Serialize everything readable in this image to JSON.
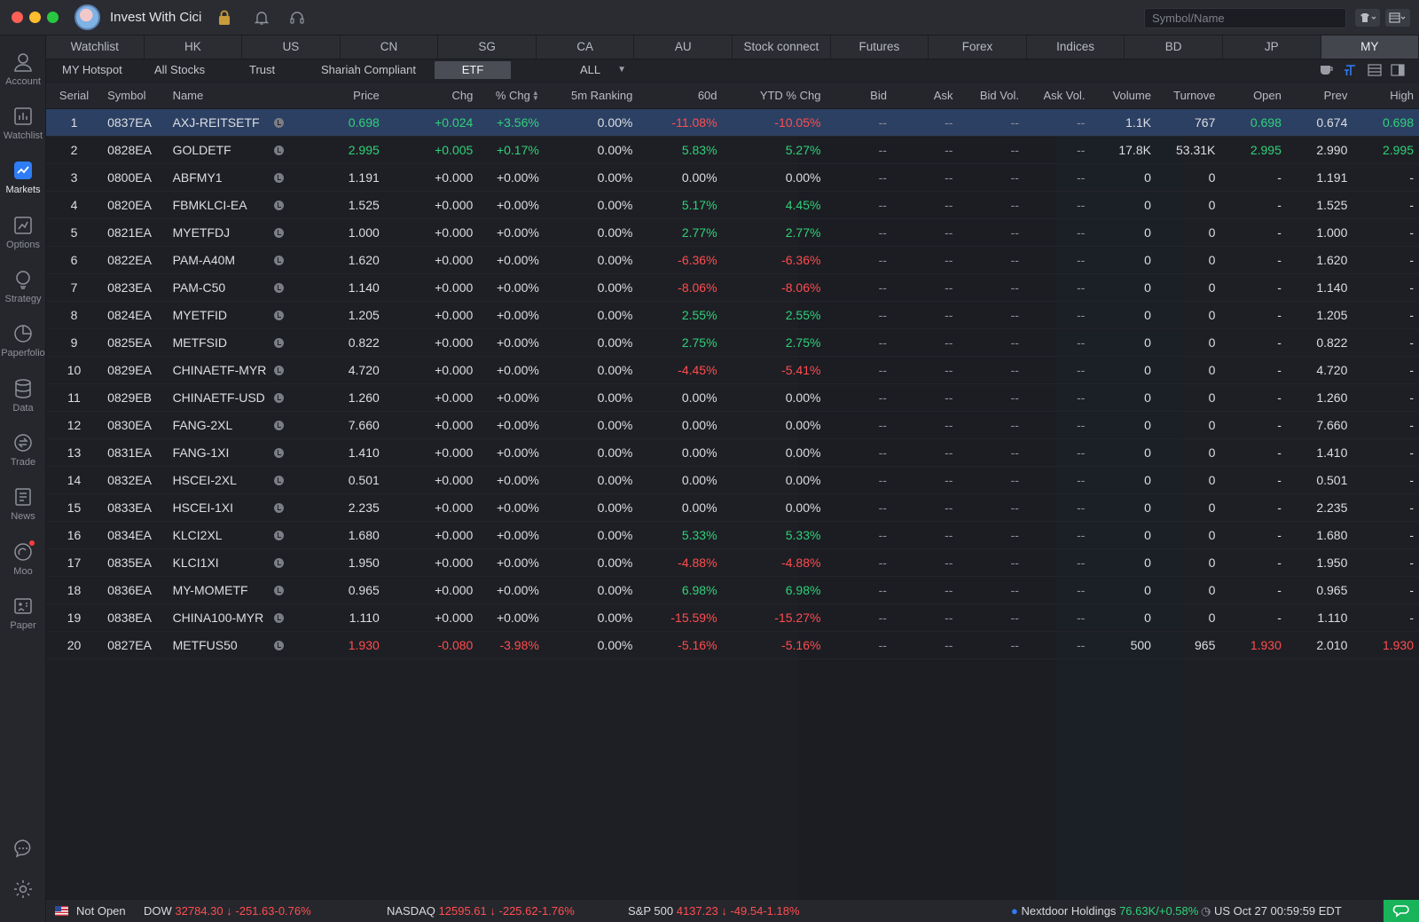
{
  "app": {
    "title": "Invest With Cici"
  },
  "search": {
    "placeholder": "Symbol/Name"
  },
  "sidebar": {
    "items": [
      {
        "label": "Account",
        "icon": "account-icon"
      },
      {
        "label": "Watchlist",
        "icon": "watchlist-icon"
      },
      {
        "label": "Markets",
        "icon": "markets-icon",
        "active": true
      },
      {
        "label": "Options",
        "icon": "options-icon"
      },
      {
        "label": "Strategy",
        "icon": "strategy-icon"
      },
      {
        "label": "Paperfolio",
        "icon": "paperfolio-icon"
      },
      {
        "label": "Data",
        "icon": "data-icon"
      },
      {
        "label": "Trade",
        "icon": "trade-icon"
      },
      {
        "label": "News",
        "icon": "news-icon"
      },
      {
        "label": "Moo",
        "icon": "moo-icon"
      },
      {
        "label": "Paper",
        "icon": "paper-icon"
      }
    ]
  },
  "market_tabs": [
    "Watchlist",
    "HK",
    "US",
    "CN",
    "SG",
    "CA",
    "AU",
    "Stock connect",
    "Futures",
    "Forex",
    "Indices",
    "BD",
    "JP",
    "MY"
  ],
  "active_market": "MY",
  "sub_tabs": {
    "hotspot": "MY Hotspot",
    "all_stocks": "All Stocks",
    "trust": "Trust",
    "shariah": "Shariah Compliant",
    "etf": "ETF",
    "filter": "ALL"
  },
  "table": {
    "columns": [
      "Serial",
      "Symbol",
      "Name",
      "Price",
      "Chg",
      "% Chg",
      "5m Ranking",
      "60d",
      "YTD % Chg",
      "Bid",
      "Ask",
      "Bid Vol.",
      "Ask Vol.",
      "Volume",
      "Turnove",
      "Open",
      "Prev",
      "High"
    ],
    "rows": [
      [
        "1",
        "0837EA",
        "AXJ-REITSETF",
        "0.698",
        "+0.024",
        "+3.56%",
        "0.00%",
        "-11.08%",
        "-10.05%",
        "--",
        "--",
        "--",
        "--",
        "1.1K",
        "767",
        "0.698",
        "0.674",
        "0.698"
      ],
      [
        "2",
        "0828EA",
        "GOLDETF",
        "2.995",
        "+0.005",
        "+0.17%",
        "0.00%",
        "5.83%",
        "5.27%",
        "--",
        "--",
        "--",
        "--",
        "17.8K",
        "53.31K",
        "2.995",
        "2.990",
        "2.995"
      ],
      [
        "3",
        "0800EA",
        "ABFMY1",
        "1.191",
        "+0.000",
        "+0.00%",
        "0.00%",
        "0.00%",
        "0.00%",
        "--",
        "--",
        "--",
        "--",
        "0",
        "0",
        "-",
        "1.191",
        "-"
      ],
      [
        "4",
        "0820EA",
        "FBMKLCI-EA",
        "1.525",
        "+0.000",
        "+0.00%",
        "0.00%",
        "5.17%",
        "4.45%",
        "--",
        "--",
        "--",
        "--",
        "0",
        "0",
        "-",
        "1.525",
        "-"
      ],
      [
        "5",
        "0821EA",
        "MYETFDJ",
        "1.000",
        "+0.000",
        "+0.00%",
        "0.00%",
        "2.77%",
        "2.77%",
        "--",
        "--",
        "--",
        "--",
        "0",
        "0",
        "-",
        "1.000",
        "-"
      ],
      [
        "6",
        "0822EA",
        "PAM-A40M",
        "1.620",
        "+0.000",
        "+0.00%",
        "0.00%",
        "-6.36%",
        "-6.36%",
        "--",
        "--",
        "--",
        "--",
        "0",
        "0",
        "-",
        "1.620",
        "-"
      ],
      [
        "7",
        "0823EA",
        "PAM-C50",
        "1.140",
        "+0.000",
        "+0.00%",
        "0.00%",
        "-8.06%",
        "-8.06%",
        "--",
        "--",
        "--",
        "--",
        "0",
        "0",
        "-",
        "1.140",
        "-"
      ],
      [
        "8",
        "0824EA",
        "MYETFID",
        "1.205",
        "+0.000",
        "+0.00%",
        "0.00%",
        "2.55%",
        "2.55%",
        "--",
        "--",
        "--",
        "--",
        "0",
        "0",
        "-",
        "1.205",
        "-"
      ],
      [
        "9",
        "0825EA",
        "METFSID",
        "0.822",
        "+0.000",
        "+0.00%",
        "0.00%",
        "2.75%",
        "2.75%",
        "--",
        "--",
        "--",
        "--",
        "0",
        "0",
        "-",
        "0.822",
        "-"
      ],
      [
        "10",
        "0829EA",
        "CHINAETF-MYR",
        "4.720",
        "+0.000",
        "+0.00%",
        "0.00%",
        "-4.45%",
        "-5.41%",
        "--",
        "--",
        "--",
        "--",
        "0",
        "0",
        "-",
        "4.720",
        "-"
      ],
      [
        "11",
        "0829EB",
        "CHINAETF-USD",
        "1.260",
        "+0.000",
        "+0.00%",
        "0.00%",
        "0.00%",
        "0.00%",
        "--",
        "--",
        "--",
        "--",
        "0",
        "0",
        "-",
        "1.260",
        "-"
      ],
      [
        "12",
        "0830EA",
        "FANG-2XL",
        "7.660",
        "+0.000",
        "+0.00%",
        "0.00%",
        "0.00%",
        "0.00%",
        "--",
        "--",
        "--",
        "--",
        "0",
        "0",
        "-",
        "7.660",
        "-"
      ],
      [
        "13",
        "0831EA",
        "FANG-1XI",
        "1.410",
        "+0.000",
        "+0.00%",
        "0.00%",
        "0.00%",
        "0.00%",
        "--",
        "--",
        "--",
        "--",
        "0",
        "0",
        "-",
        "1.410",
        "-"
      ],
      [
        "14",
        "0832EA",
        "HSCEI-2XL",
        "0.501",
        "+0.000",
        "+0.00%",
        "0.00%",
        "0.00%",
        "0.00%",
        "--",
        "--",
        "--",
        "--",
        "0",
        "0",
        "-",
        "0.501",
        "-"
      ],
      [
        "15",
        "0833EA",
        "HSCEI-1XI",
        "2.235",
        "+0.000",
        "+0.00%",
        "0.00%",
        "0.00%",
        "0.00%",
        "--",
        "--",
        "--",
        "--",
        "0",
        "0",
        "-",
        "2.235",
        "-"
      ],
      [
        "16",
        "0834EA",
        "KLCI2XL",
        "1.680",
        "+0.000",
        "+0.00%",
        "0.00%",
        "5.33%",
        "5.33%",
        "--",
        "--",
        "--",
        "--",
        "0",
        "0",
        "-",
        "1.680",
        "-"
      ],
      [
        "17",
        "0835EA",
        "KLCI1XI",
        "1.950",
        "+0.000",
        "+0.00%",
        "0.00%",
        "-4.88%",
        "-4.88%",
        "--",
        "--",
        "--",
        "--",
        "0",
        "0",
        "-",
        "1.950",
        "-"
      ],
      [
        "18",
        "0836EA",
        "MY-MOMETF",
        "0.965",
        "+0.000",
        "+0.00%",
        "0.00%",
        "6.98%",
        "6.98%",
        "--",
        "--",
        "--",
        "--",
        "0",
        "0",
        "-",
        "0.965",
        "-"
      ],
      [
        "19",
        "0838EA",
        "CHINA100-MYR",
        "1.110",
        "+0.000",
        "+0.00%",
        "0.00%",
        "-15.59%",
        "-15.27%",
        "--",
        "--",
        "--",
        "--",
        "0",
        "0",
        "-",
        "1.110",
        "-"
      ],
      [
        "20",
        "0827EA",
        "METFUS50",
        "1.930",
        "-0.080",
        "-3.98%",
        "0.00%",
        "-5.16%",
        "-5.16%",
        "--",
        "--",
        "--",
        "--",
        "500",
        "965",
        "1.930",
        "2.010",
        "1.930"
      ]
    ]
  },
  "status_bar": {
    "market_state": "Not Open",
    "dow": {
      "name": "DOW",
      "value": "32784.30",
      "change": "-251.63",
      "pct": "-0.76%"
    },
    "nasdaq": {
      "name": "NASDAQ",
      "value": "12595.61",
      "change": "-225.62",
      "pct": "-1.76%"
    },
    "sp500": {
      "name": "S&P 500",
      "value": "4137.23",
      "change": "-49.54",
      "pct": "-1.18%"
    },
    "ticker": {
      "name": "Nextdoor Holdings",
      "value": "76.63K/+0.58%"
    },
    "clock": "US Oct 27 00:59:59 EDT"
  },
  "colors": {
    "up": "#2fd27a",
    "down": "#ff4d4f",
    "accent": "#2f7df6",
    "selected_row": "#2c4063"
  }
}
